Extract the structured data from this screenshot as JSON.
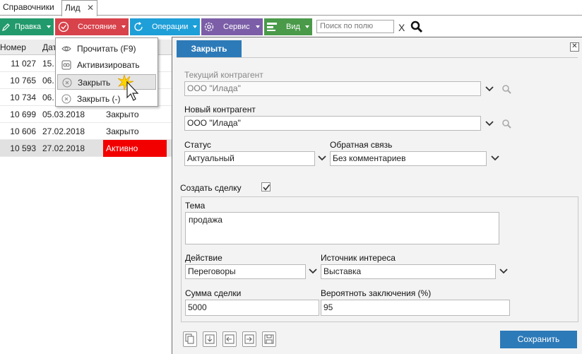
{
  "tabs": [
    {
      "label": "Справочники"
    },
    {
      "label": "Лид",
      "close": "✕"
    }
  ],
  "toolbar": {
    "pravka": "Правка",
    "state": "Состояние",
    "operations": "Операции",
    "service": "Сервис",
    "view": "Вид",
    "search_placeholder": "Поиск по полю",
    "search_clear": "X"
  },
  "grid": {
    "headers": [
      "Номер",
      "Дат",
      "С"
    ],
    "rows": [
      {
        "num": "11 027",
        "date": "15.",
        "status": ""
      },
      {
        "num": "10 765",
        "date": "06.",
        "status": ""
      },
      {
        "num": "10 734",
        "date": "06.",
        "status": ""
      },
      {
        "num": "10 699",
        "date": "05.03.2018",
        "status": "Закрыто"
      },
      {
        "num": "10 606",
        "date": "27.02.2018",
        "status": "Закрыто"
      },
      {
        "num": "10 593",
        "date": "27.02.2018",
        "status": "Активно"
      }
    ]
  },
  "menu": {
    "items": [
      {
        "label": "Прочитать (F9)",
        "icon": "eye-icon"
      },
      {
        "label": "Активизировать",
        "icon": "activate-icon"
      },
      {
        "label": "Закрыть",
        "icon": "close-circle-icon"
      },
      {
        "label": "Закрыть (-)",
        "icon": "close-circle-icon"
      }
    ]
  },
  "dialog": {
    "title": "Закрыть",
    "current_contractor_label": "Текущий контрагент",
    "current_contractor": "ООО \"Илада\"",
    "new_contractor_label": "Новый контрагент",
    "new_contractor": "ООО \"Илада\"",
    "status_label": "Статус",
    "status": "Актуальный",
    "feedback_label": "Обратная связь",
    "feedback": "Без комментариев",
    "create_deal_label": "Создать сделку",
    "create_deal_checked": true,
    "topic_label": "Тема",
    "topic": "продажа",
    "action_label": "Действие",
    "action": "Переговоры",
    "source_label": "Источник интереса",
    "source": "Выставка",
    "amount_label": "Сумма сделки",
    "amount": "5000",
    "probability_label": "Вероятноть заключения (%)",
    "probability": "95",
    "save_label": "Сохранить"
  },
  "colors": {
    "pravka": "#229a6c",
    "state": "#d8424b",
    "operations": "#1e9fd8",
    "service": "#7b5ea7",
    "view": "#4a9a4a",
    "dialog_accent": "#2d7ab8",
    "active_status": "#f20000"
  }
}
